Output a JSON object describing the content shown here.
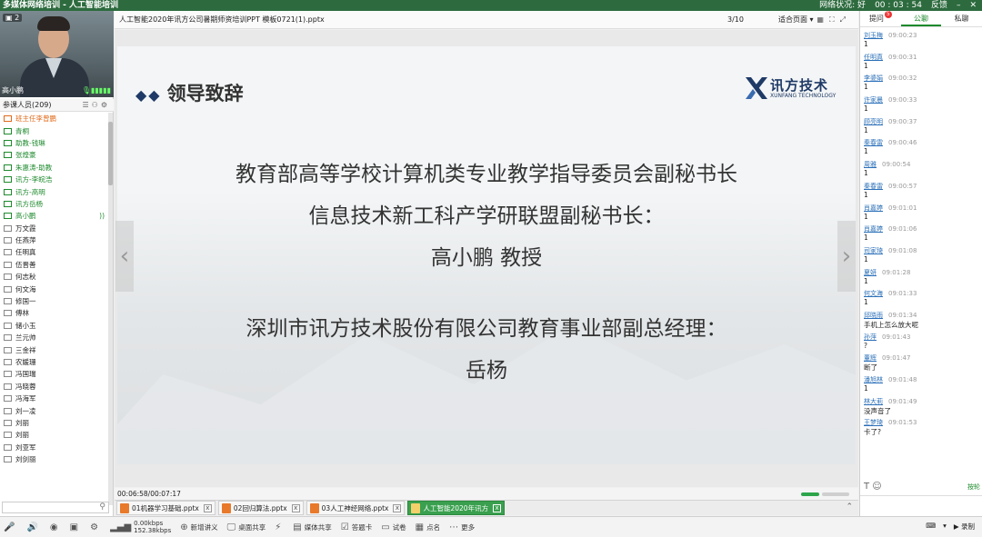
{
  "titlebar": {
    "title": "多媒体网络培训 - 人工智能培训",
    "network_label": "网络状况:",
    "network_value": "好",
    "clock": "00 : 03 : 54",
    "feedback": "反馈"
  },
  "video": {
    "cam_badge": "2",
    "name": "高小鹏"
  },
  "roster": {
    "header": "参课人员(209)",
    "items": [
      {
        "name": "班主任李曾鹏",
        "kind": "host"
      },
      {
        "name": "青桐",
        "kind": "green"
      },
      {
        "name": "助教-钱琳",
        "kind": "green"
      },
      {
        "name": "张煌豪",
        "kind": "green"
      },
      {
        "name": "朱惠涛-助教",
        "kind": "green"
      },
      {
        "name": "讯方-李皖浩",
        "kind": "green"
      },
      {
        "name": "讯方-高明",
        "kind": "green"
      },
      {
        "name": "讯方岳杨",
        "kind": "green"
      },
      {
        "name": "高小鹏",
        "kind": "green",
        "speaking": true
      },
      {
        "name": "万文霞",
        "kind": "normal"
      },
      {
        "name": "任燕萍",
        "kind": "normal"
      },
      {
        "name": "任明真",
        "kind": "normal"
      },
      {
        "name": "伍晋善",
        "kind": "normal"
      },
      {
        "name": "何志秋",
        "kind": "normal"
      },
      {
        "name": "何文海",
        "kind": "normal"
      },
      {
        "name": "修国一",
        "kind": "normal"
      },
      {
        "name": "傅林",
        "kind": "normal"
      },
      {
        "name": "储小玉",
        "kind": "normal"
      },
      {
        "name": "兰元帅",
        "kind": "normal"
      },
      {
        "name": "三金祥",
        "kind": "normal"
      },
      {
        "name": "农媛珊",
        "kind": "normal"
      },
      {
        "name": "冯国瑞",
        "kind": "normal"
      },
      {
        "name": "冯晓蓉",
        "kind": "normal"
      },
      {
        "name": "冯海军",
        "kind": "normal"
      },
      {
        "name": "刘一凌",
        "kind": "normal"
      },
      {
        "name": "刘丽",
        "kind": "normal"
      },
      {
        "name": "刘丽",
        "kind": "normal"
      },
      {
        "name": "刘亚军",
        "kind": "normal"
      },
      {
        "name": "刘剑丽",
        "kind": "normal"
      }
    ]
  },
  "doc": {
    "filename": "人工智能2020年讯方公司暑期师资培训PPT 模板0721(1).pptx",
    "page": "3/10",
    "fit": "适合页面",
    "elapsed": "00:06:58/00:07:17"
  },
  "slide": {
    "title": "领导致辞",
    "logo_text": "讯方技术",
    "logo_sub": "XUNFANG TECHNOLOGY",
    "line1": "教育部高等学校计算机类专业教学指导委员会副秘书长",
    "line2": "信息技术新工科产学研联盟副秘书长：",
    "line3": "高小鹏 教授",
    "line4": "深圳市讯方技术股份有限公司教育事业部副总经理：",
    "line5": "岳杨"
  },
  "doc_tabs": [
    {
      "label": "01机器学习基础.pptx",
      "active": false
    },
    {
      "label": "02回归算法.pptx",
      "active": false
    },
    {
      "label": "03人工神经网络.pptx",
      "active": false
    },
    {
      "label": "人工智能2020年讯方",
      "active": true
    }
  ],
  "right": {
    "tab_question": "提问",
    "tab_question_badge": "5",
    "tab_public": "公聊",
    "tab_private": "私聊",
    "tool_right": "按轮",
    "messages": [
      {
        "who": "刘玉梅",
        "time": "09:00:23",
        "text": "1"
      },
      {
        "who": "任明真",
        "time": "09:00:31",
        "text": "1"
      },
      {
        "who": "李婆娟",
        "time": "09:00:32",
        "text": "1"
      },
      {
        "who": "许家晨",
        "time": "09:00:33",
        "text": "1"
      },
      {
        "who": "顾亮明",
        "time": "09:00:37",
        "text": "1"
      },
      {
        "who": "秦春雷",
        "time": "09:00:46",
        "text": "1"
      },
      {
        "who": "周雅",
        "time": "09:00:54",
        "text": "1"
      },
      {
        "who": "秦春雷",
        "time": "09:00:57",
        "text": "1"
      },
      {
        "who": "肖嘉婷",
        "time": "09:01:01",
        "text": "1"
      },
      {
        "who": "肖嘉婷",
        "time": "09:01:06",
        "text": "1"
      },
      {
        "who": "司家琦",
        "time": "09:01:08",
        "text": "1"
      },
      {
        "who": "夏妍",
        "time": "09:01:28",
        "text": "1"
      },
      {
        "who": "何文海",
        "time": "09:01:33",
        "text": "1"
      },
      {
        "who": "邱晓雨",
        "time": "09:01:34",
        "text": "手机上怎么放大呢"
      },
      {
        "who": "孙萍",
        "time": "09:01:43",
        "text": "?"
      },
      {
        "who": "董辉",
        "time": "09:01:47",
        "text": "断了"
      },
      {
        "who": "潘旭林",
        "time": "09:01:48",
        "text": "1"
      },
      {
        "who": "林大莉",
        "time": "09:01:49",
        "text": "没声音了"
      },
      {
        "who": "王梦琦",
        "time": "09:01:53",
        "text": "卡了?"
      }
    ]
  },
  "bottombar": {
    "speed_up": "0.00kbps",
    "speed_down": "152.38kbps",
    "new_lecture": "新增讲义",
    "desktop_share": "桌面共享",
    "media_share": "媒体共享",
    "answer_card": "答题卡",
    "quiz": "试卷",
    "roll_call": "点名",
    "more": "更多",
    "record": "录制"
  },
  "colors": {
    "titlebar": "#2d6b3e",
    "accent_green": "#1d8a2c",
    "host_orange": "#e06a1a",
    "slide_navy": "#1f3a66"
  }
}
